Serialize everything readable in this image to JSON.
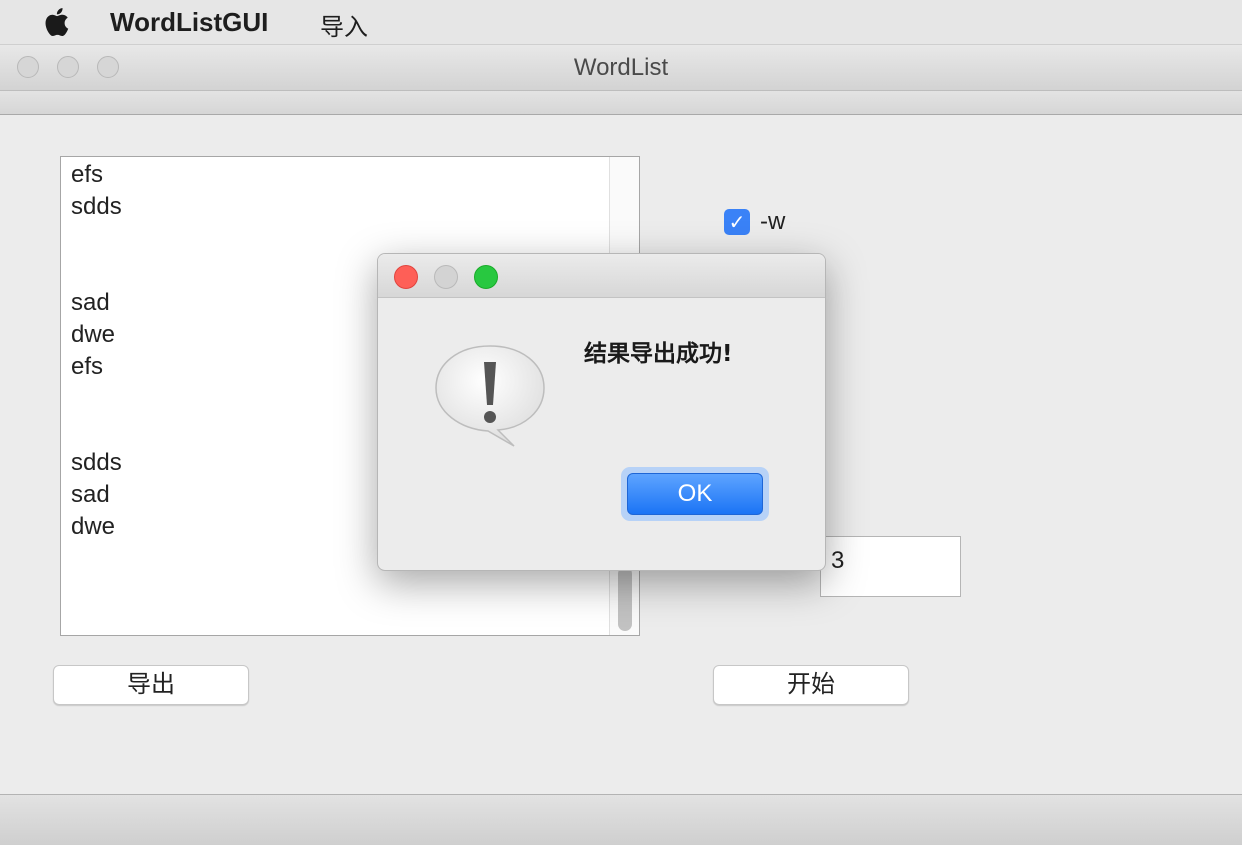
{
  "menubar": {
    "app_name": "WordListGUI",
    "import_menu": "导入"
  },
  "window": {
    "title": "WordList"
  },
  "wordlist": {
    "lines": [
      "efs",
      "sdds",
      "",
      "",
      "sad",
      "dwe",
      "efs",
      "",
      "",
      "sdds",
      "sad",
      "dwe"
    ]
  },
  "options": {
    "w_flag": {
      "label": "-w",
      "checked": true
    },
    "number_value": "3"
  },
  "buttons": {
    "export_label": "导出",
    "start_label": "开始"
  },
  "dialog": {
    "message": "结果导出成功!",
    "ok_label": "OK",
    "icon": "warning-exclamation-icon"
  },
  "colors": {
    "accent": "#3a82f7",
    "close_red": "#fe5f57",
    "zoom_green": "#28c840"
  }
}
